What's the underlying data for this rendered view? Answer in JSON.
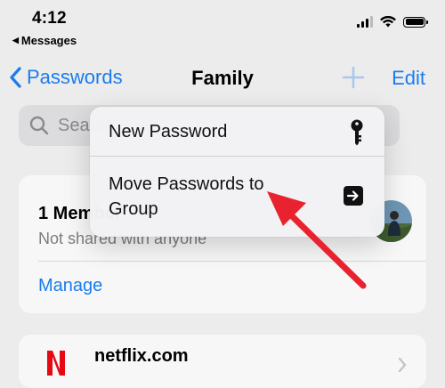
{
  "status_bar": {
    "time": "4:12",
    "back_label": "Messages"
  },
  "nav": {
    "back_label": "Passwords",
    "title": "Family",
    "edit_label": "Edit"
  },
  "search": {
    "placeholder": "Search"
  },
  "members_card": {
    "title": "1 Member",
    "subtitle": "Not shared with anyone",
    "manage_label": "Manage"
  },
  "list": {
    "items": [
      {
        "label": "netflix.com",
        "icon": "netflix-logo-icon"
      }
    ]
  },
  "menu": {
    "items": [
      {
        "label": "New Password",
        "icon": "key-icon"
      },
      {
        "label": "Move Passwords to Group",
        "icon": "arrow-right-square-icon"
      }
    ]
  },
  "colors": {
    "accent": "#1a7cf0",
    "annotation_arrow": "#e8232f",
    "background": "#ececec"
  }
}
